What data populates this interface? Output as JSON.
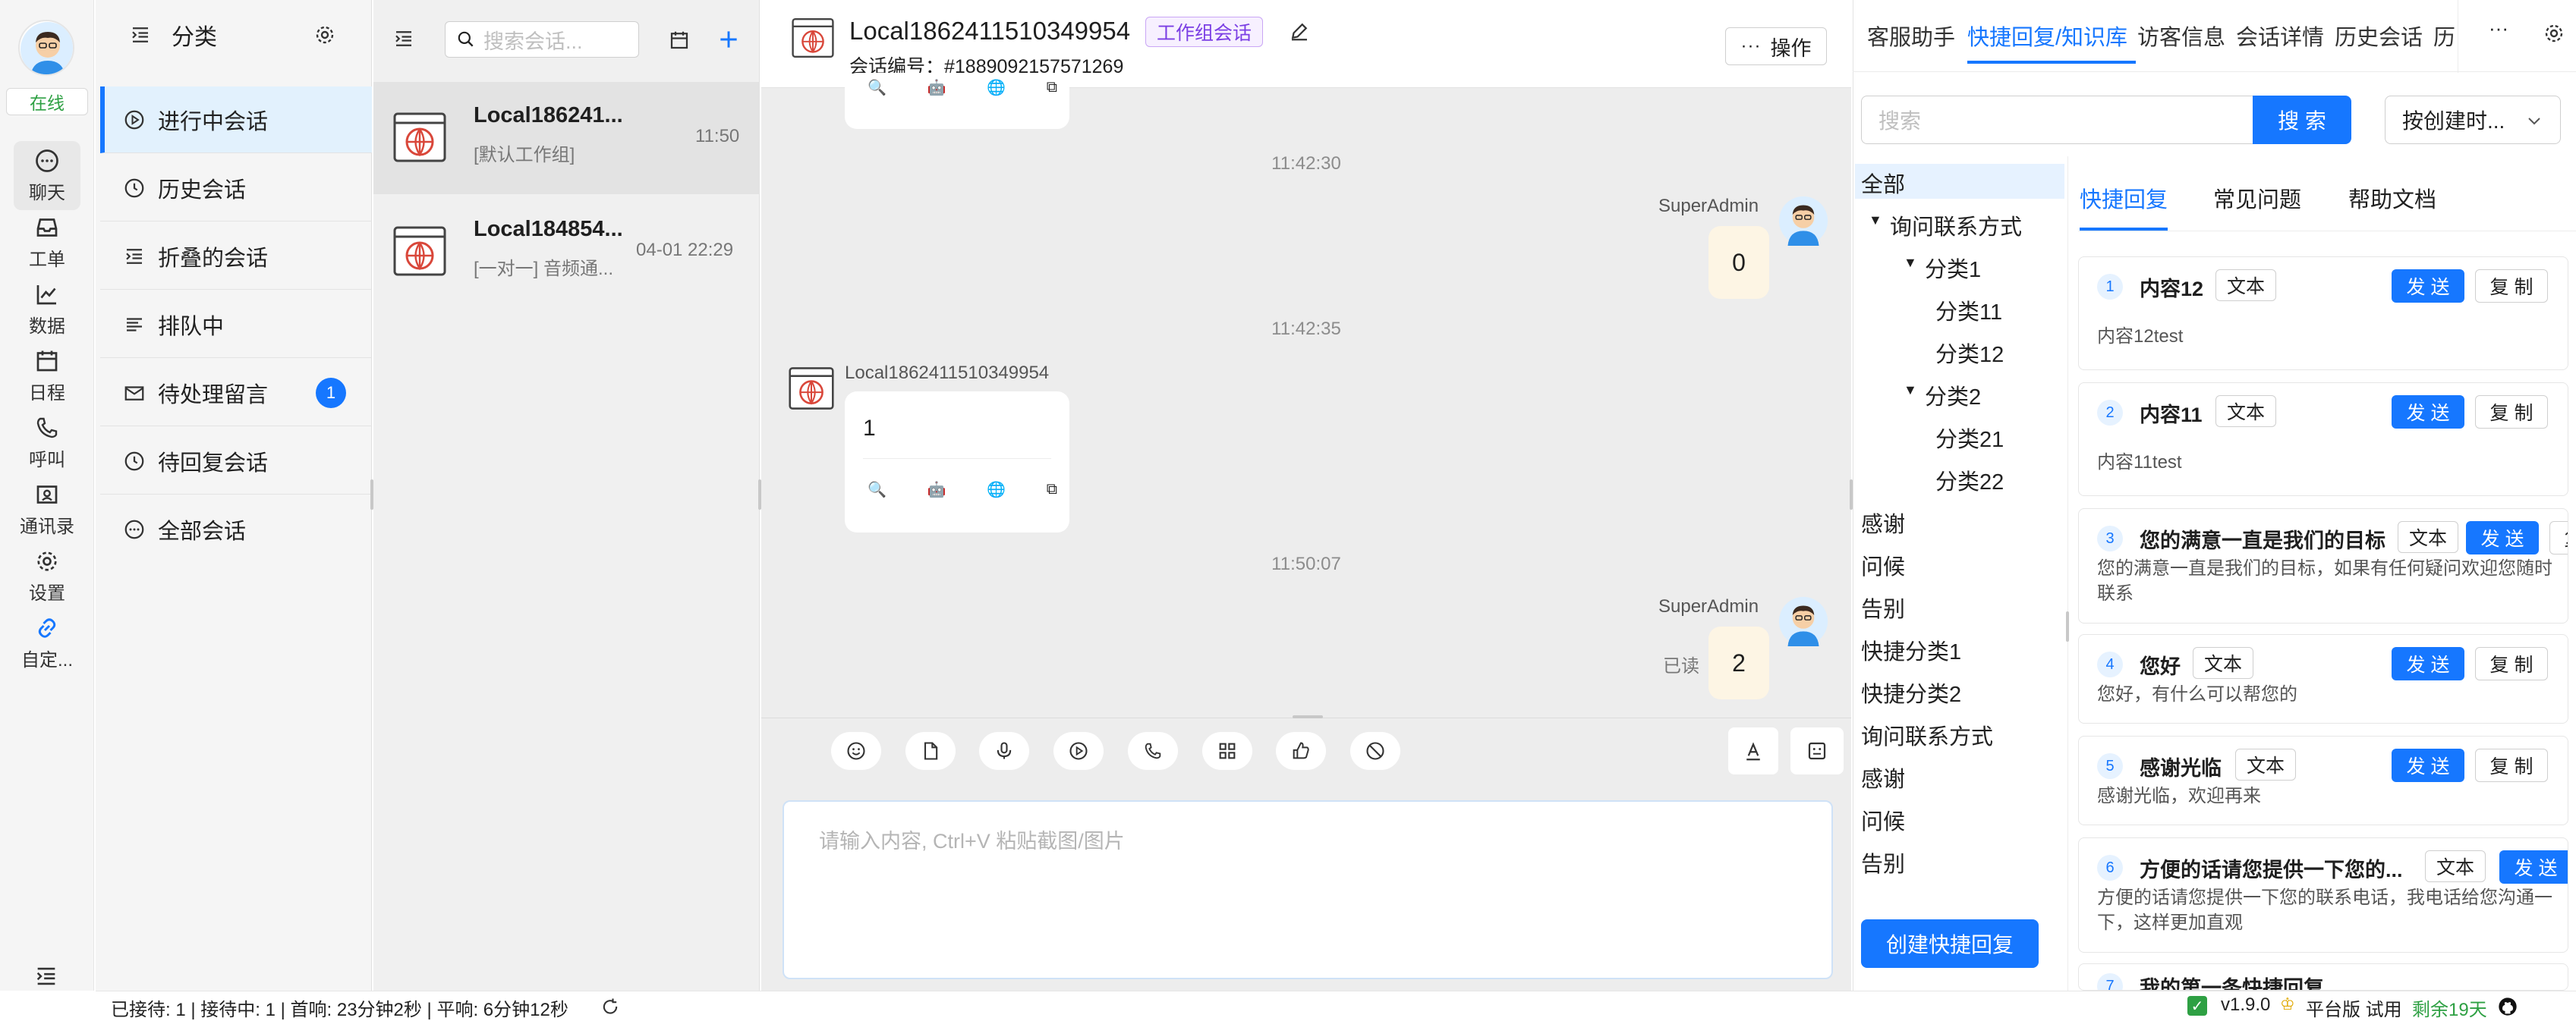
{
  "rail": {
    "status": "在线",
    "items": [
      {
        "label": "聊天",
        "icon": "chat-icon"
      },
      {
        "label": "工单",
        "icon": "inbox-icon"
      },
      {
        "label": "数据",
        "icon": "chart-icon"
      },
      {
        "label": "日程",
        "icon": "calendar-icon"
      },
      {
        "label": "呼叫",
        "icon": "phone-icon"
      },
      {
        "label": "通讯录",
        "icon": "contacts-icon"
      },
      {
        "label": "设置",
        "icon": "gear-icon"
      },
      {
        "label": "自定...",
        "icon": "link-icon"
      }
    ]
  },
  "category": {
    "title": "分类",
    "items": [
      {
        "label": "进行中会话",
        "icon": "play-circle-icon"
      },
      {
        "label": "历史会话",
        "icon": "clock-icon"
      },
      {
        "label": "折叠的会话",
        "icon": "fold-icon"
      },
      {
        "label": "排队中",
        "icon": "queue-icon"
      },
      {
        "label": "待处理留言",
        "icon": "mail-icon",
        "badge": "1"
      },
      {
        "label": "待回复会话",
        "icon": "clock-icon"
      },
      {
        "label": "全部会话",
        "icon": "message-dots-icon"
      }
    ]
  },
  "conversations": {
    "search_placeholder": "搜索会话...",
    "items": [
      {
        "name": "Local186241...",
        "preview": "[默认工作组]",
        "time": "11:50"
      },
      {
        "name": "Local184854...",
        "preview": "[一对一] 音频通...",
        "time": "04-01 22:29"
      }
    ]
  },
  "chat": {
    "title": "Local1862411510349954",
    "group_tag": "工作组会话",
    "session_label": "会话编号：#1889092157571269",
    "action_label": "操作",
    "messages": [
      {
        "kind": "time",
        "text": "11:42:30"
      },
      {
        "kind": "agent",
        "sender": "SuperAdmin",
        "text": "0"
      },
      {
        "kind": "time",
        "text": "11:42:35"
      },
      {
        "kind": "visitor",
        "sender": "Local1862411510349954",
        "text": "1"
      },
      {
        "kind": "time",
        "text": "11:50:07"
      },
      {
        "kind": "agent",
        "sender": "SuperAdmin",
        "text": "2",
        "read": "已读"
      }
    ],
    "input_placeholder": "请输入内容, Ctrl+V 粘贴截图/图片"
  },
  "right": {
    "tabs": [
      "客服助手",
      "快捷回复/知识库",
      "访客信息",
      "会话详情",
      "历史会话",
      "历"
    ],
    "active_tab": "快捷回复/知识库",
    "search_placeholder": "搜索",
    "search_button": "搜 索",
    "sort_label": "按创建时...",
    "tree": [
      {
        "label": "全部",
        "level": 0
      },
      {
        "label": "询问联系方式",
        "level": 1,
        "expanded": true
      },
      {
        "label": "分类1",
        "level": 2,
        "expanded": true
      },
      {
        "label": "分类11",
        "level": 3
      },
      {
        "label": "分类12",
        "level": 3
      },
      {
        "label": "分类2",
        "level": 2,
        "expanded": true
      },
      {
        "label": "分类21",
        "level": 3
      },
      {
        "label": "分类22",
        "level": 3
      },
      {
        "label": "感谢",
        "level": 0
      },
      {
        "label": "问候",
        "level": 0
      },
      {
        "label": "告别",
        "level": 0
      },
      {
        "label": "快捷分类1",
        "level": 0
      },
      {
        "label": "快捷分类2",
        "level": 0
      },
      {
        "label": "询问联系方式",
        "level": 0
      },
      {
        "label": "感谢",
        "level": 0
      },
      {
        "label": "问候",
        "level": 0
      },
      {
        "label": "告别",
        "level": 0
      }
    ],
    "create_button": "创建快捷回复",
    "subtabs": [
      "快捷回复",
      "常见问题",
      "帮助文档"
    ],
    "cards": [
      {
        "num": "1",
        "title": "内容12",
        "tag": "文本",
        "body": "内容12test"
      },
      {
        "num": "2",
        "title": "内容11",
        "tag": "文本",
        "body": "内容11test"
      },
      {
        "num": "3",
        "title": "您的满意一直是我们的目标",
        "tag": "文本",
        "body": "您的满意一直是我们的目标，如果有任何疑问欢迎您随时联系"
      },
      {
        "num": "4",
        "title": "您好",
        "tag": "文本",
        "body": "您好，有什么可以帮您的"
      },
      {
        "num": "5",
        "title": "感谢光临",
        "tag": "文本",
        "body": "感谢光临，欢迎再来"
      },
      {
        "num": "6",
        "title": "方便的话请您提供一下您的...",
        "tag": "文本",
        "body": "方便的话请您提供一下您的联系电话，我电话给您沟通一下，这样更加直观"
      },
      {
        "num": "7",
        "title": "我的第一条快捷回复",
        "tag": "文本",
        "body": ""
      }
    ],
    "send_label": "发 送",
    "copy_label": "复 制"
  },
  "footer": {
    "stats": "已接待: 1 | 接待中: 1 | 首响: 23分钟2秒 | 平响: 6分钟12秒",
    "version": "v1.9.0",
    "edition": "平台版 试用",
    "remaining": "剩余19天"
  },
  "colors": {
    "accent": "#1677ff",
    "online": "#2ea043",
    "badge": "#1677ff",
    "tag_purple": "#7b3fe4"
  }
}
